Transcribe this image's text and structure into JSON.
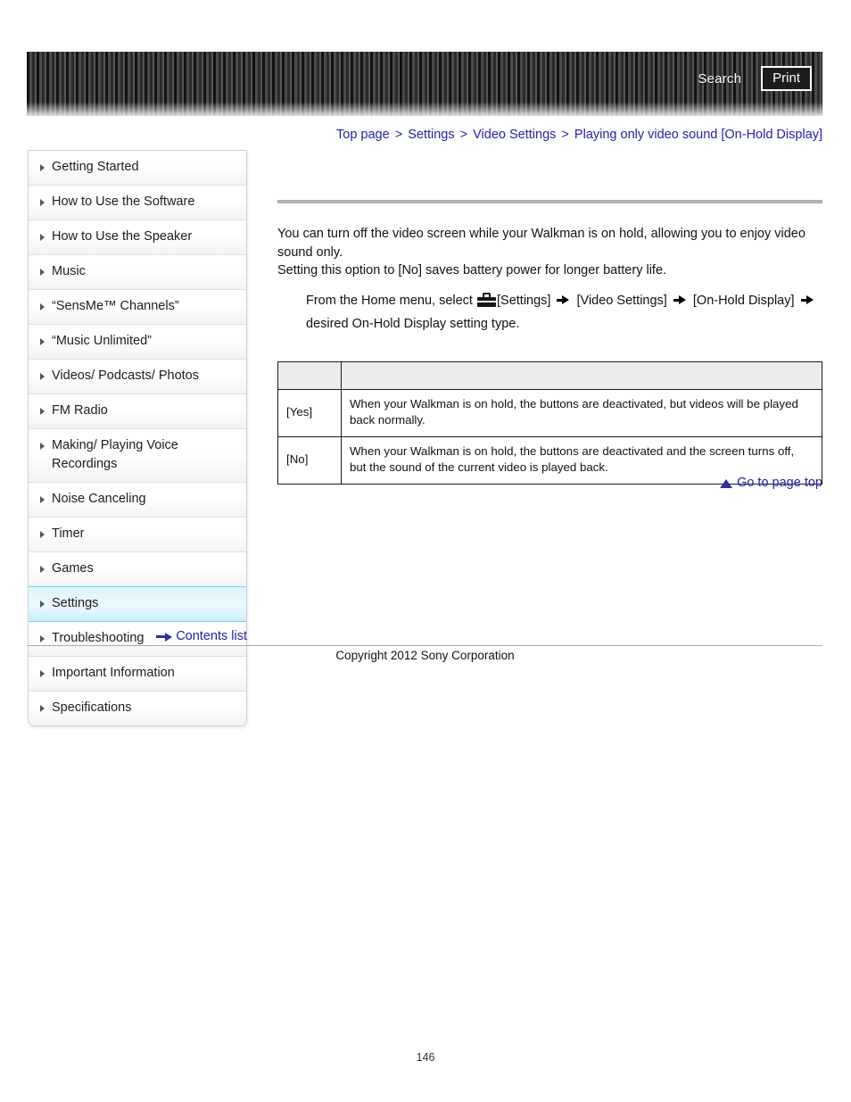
{
  "header": {
    "search_label": "Search",
    "print_label": "Print"
  },
  "breadcrumb": {
    "separator": ">",
    "items": [
      {
        "label": "Top page"
      },
      {
        "label": "Settings"
      },
      {
        "label": "Video Settings"
      },
      {
        "label": "Playing only video sound [On-Hold Display]"
      }
    ]
  },
  "sidebar": {
    "items": [
      {
        "label": "Getting Started",
        "active": false
      },
      {
        "label": "How to Use the Software",
        "active": false
      },
      {
        "label": "How to Use the Speaker",
        "active": false
      },
      {
        "label": "Music",
        "active": false
      },
      {
        "label": "“SensMe™ Channels”",
        "active": false
      },
      {
        "label": "“Music Unlimited”",
        "active": false
      },
      {
        "label": "Videos/ Podcasts/ Photos",
        "active": false
      },
      {
        "label": "FM Radio",
        "active": false
      },
      {
        "label": "Making/ Playing Voice Recordings",
        "active": false
      },
      {
        "label": "Noise Canceling",
        "active": false
      },
      {
        "label": "Timer",
        "active": false
      },
      {
        "label": "Games",
        "active": false
      },
      {
        "label": "Settings",
        "active": true
      },
      {
        "label": "Troubleshooting",
        "active": false
      },
      {
        "label": "Important Information",
        "active": false
      },
      {
        "label": "Specifications",
        "active": false
      }
    ],
    "contents_list_label": "Contents list"
  },
  "main": {
    "intro_line1": "You can turn off the video screen while your Walkman is on hold, allowing you to enjoy video sound only.",
    "intro_line2": "Setting this option to [No] saves battery power for longer battery life.",
    "procedure": {
      "prefix": "From the Home menu, select",
      "step1": "[Settings]",
      "step2": "[Video Settings]",
      "step3": "[On-Hold Display]",
      "suffix": "desired On-Hold Display setting type."
    },
    "table": {
      "headers": [
        "",
        ""
      ],
      "rows": [
        {
          "key": "[Yes]",
          "description": "When your Walkman is on hold, the buttons are deactivated, but videos will be played back normally."
        },
        {
          "key": "[No]",
          "description": "When your Walkman is on hold, the buttons are deactivated and the screen turns off, but the sound of the current video is played back."
        }
      ]
    },
    "go_to_page_top_label": "Go to page top"
  },
  "footer": {
    "copyright": "Copyright 2012 Sony Corporation",
    "page_number": "146"
  }
}
